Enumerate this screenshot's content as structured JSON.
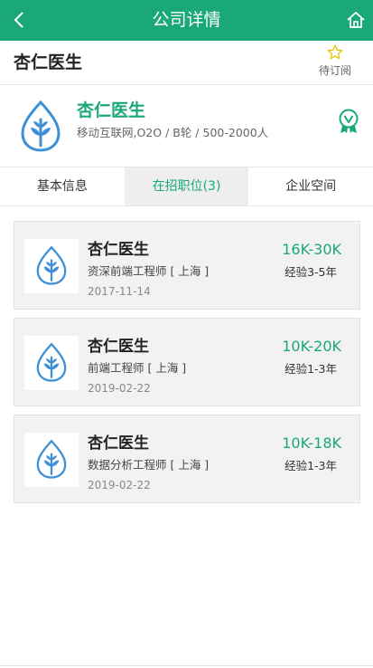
{
  "header": {
    "title": "公司详情",
    "back_icon": "chevron-left-icon",
    "home_icon": "home-icon"
  },
  "company_bar": {
    "name": "杏仁医生",
    "subscribe_label": "待订阅",
    "subscribe_icon": "star-outline-icon"
  },
  "company_card": {
    "name": "杏仁医生",
    "meta": "移动互联网,O2O / B轮 / 500-2000人",
    "badge_icon": "verified-badge-icon"
  },
  "tabs": [
    {
      "label": "基本信息",
      "active": false
    },
    {
      "label": "在招职位(3)",
      "active": true
    },
    {
      "label": "企业空间",
      "active": false
    }
  ],
  "jobs": [
    {
      "company": "杏仁医生",
      "title": "资深前端工程师 [ 上海 ]",
      "date": "2017-11-14",
      "salary": "16K-30K",
      "experience": "经验3-5年"
    },
    {
      "company": "杏仁医生",
      "title": "前端工程师 [ 上海 ]",
      "date": "2019-02-22",
      "salary": "10K-20K",
      "experience": "经验1-3年"
    },
    {
      "company": "杏仁医生",
      "title": "数据分析工程师 [ 上海 ]",
      "date": "2019-02-22",
      "salary": "10K-18K",
      "experience": "经验1-3年"
    }
  ],
  "colors": {
    "brand": "#1aa877",
    "accent_star": "#e6c200"
  }
}
